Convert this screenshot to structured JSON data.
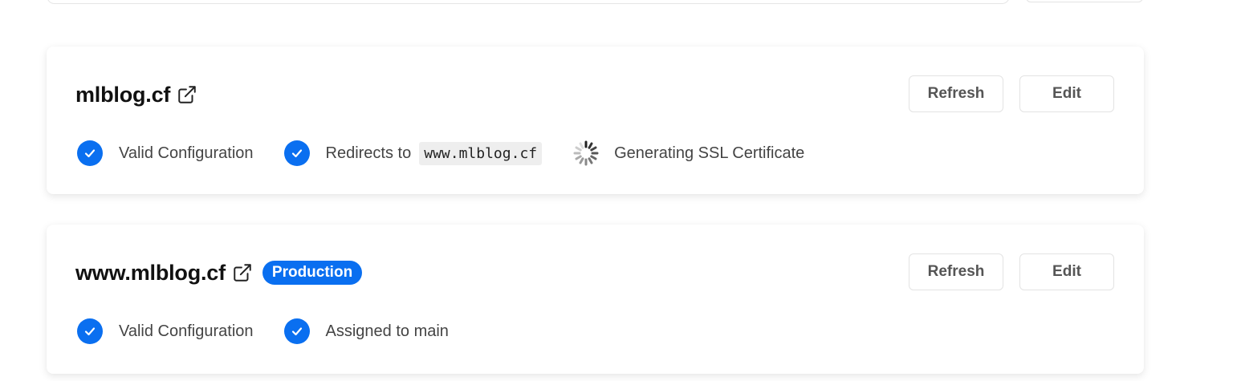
{
  "cards": [
    {
      "domain": "mlblog.cf",
      "badge": "",
      "refresh_label": "Refresh",
      "edit_label": "Edit",
      "statuses": {
        "valid": "Valid Configuration",
        "redirect": "Redirects to",
        "redirect_target": "www.mlblog.cf",
        "ssl": "Generating SSL Certificate"
      }
    },
    {
      "domain": "www.mlblog.cf",
      "badge": "Production",
      "refresh_label": "Refresh",
      "edit_label": "Edit",
      "statuses": {
        "valid": "Valid Configuration",
        "assigned": "Assigned to main"
      }
    }
  ],
  "icons": {
    "external_link": "external-link-icon",
    "check": "check-circle-icon",
    "spinner": "loading-spinner-icon"
  },
  "colors": {
    "accent": "#0a6ff0",
    "code_bg": "#eeeeee"
  }
}
